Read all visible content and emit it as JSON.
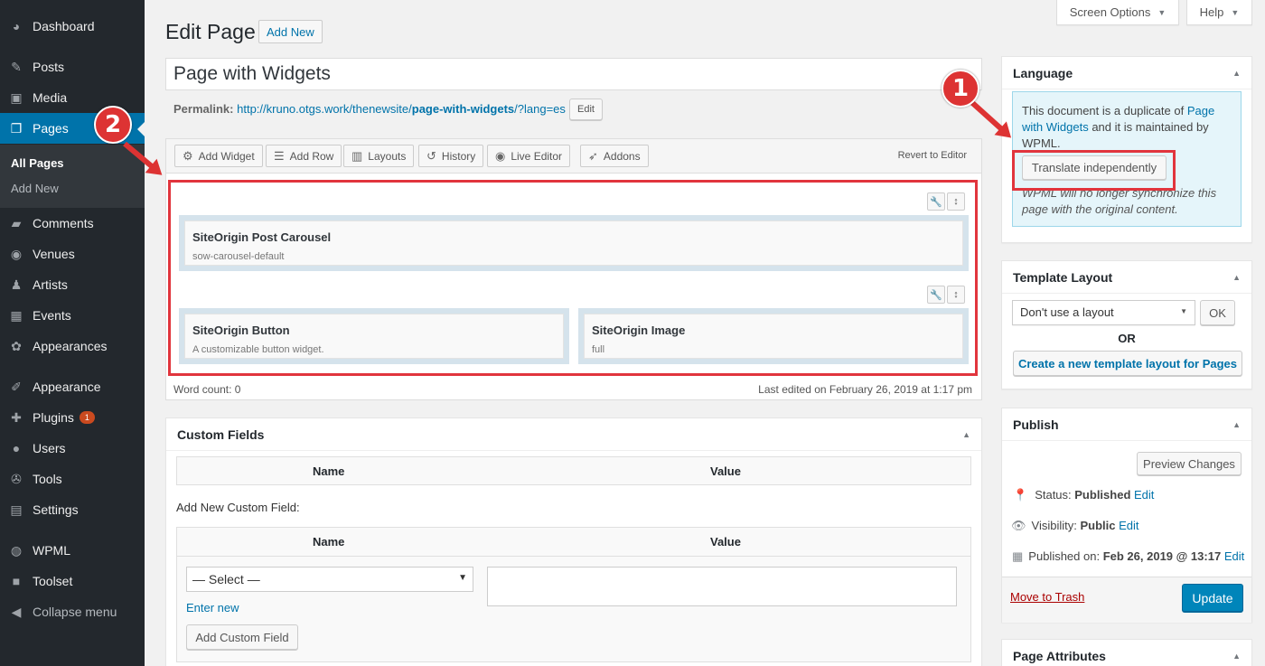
{
  "sidebar": {
    "items": [
      {
        "label": "Dashboard",
        "icon": "dashboard-icon"
      },
      {
        "label": "Posts",
        "icon": "pin-icon"
      },
      {
        "label": "Media",
        "icon": "media-icon"
      },
      {
        "label": "Pages",
        "icon": "pages-icon"
      },
      {
        "label": "Comments",
        "icon": "comment-icon"
      },
      {
        "label": "Venues",
        "icon": "globe-icon"
      },
      {
        "label": "Artists",
        "icon": "users-icon"
      },
      {
        "label": "Events",
        "icon": "calendar-icon"
      },
      {
        "label": "Appearances",
        "icon": "palette-icon"
      },
      {
        "label": "Appearance",
        "icon": "brush-icon"
      },
      {
        "label": "Plugins",
        "icon": "plugin-icon",
        "badge": "1"
      },
      {
        "label": "Users",
        "icon": "user-icon"
      },
      {
        "label": "Tools",
        "icon": "wrench-icon"
      },
      {
        "label": "Settings",
        "icon": "settings-icon"
      },
      {
        "label": "WPML",
        "icon": "wpml-icon"
      },
      {
        "label": "Toolset",
        "icon": "toolset-icon"
      },
      {
        "label": "Collapse menu",
        "icon": "collapse-icon"
      }
    ],
    "submenu": [
      "All Pages",
      "Add New"
    ]
  },
  "top": {
    "screen_options": "Screen Options",
    "help": "Help"
  },
  "header": {
    "title": "Edit Page",
    "add_new": "Add New"
  },
  "post": {
    "title": "Page with Widgets",
    "permalink_label": "Permalink:",
    "permalink_base": "http://kruno.otgs.work/thenewsite/",
    "permalink_slug": "page-with-widgets",
    "permalink_tail": "/?lang=es",
    "permalink_edit": "Edit"
  },
  "builder": {
    "toolbar": [
      "Add Widget",
      "Add Row",
      "Layouts",
      "History",
      "Live Editor",
      "Addons"
    ],
    "revert": "Revert to Editor",
    "widgets": [
      {
        "title": "SiteOrigin Post Carousel",
        "desc": "sow-carousel-default"
      },
      {
        "title": "SiteOrigin Button",
        "desc": "A customizable button widget."
      },
      {
        "title": "SiteOrigin Image",
        "desc": "full"
      }
    ],
    "word_count": "Word count: 0",
    "last_edited": "Last edited on February 26, 2019 at 1:17 pm"
  },
  "custom_fields": {
    "title": "Custom Fields",
    "col_name": "Name",
    "col_value": "Value",
    "add_new_label": "Add New Custom Field:",
    "select_value": "— Select —",
    "enter_new": "Enter new",
    "add_button": "Add Custom Field"
  },
  "language": {
    "title": "Language",
    "note_pre": "This document is a duplicate of ",
    "note_link": "Page with Widgets",
    "note_post": " and it is maintained by WPML.",
    "button": "Translate independently",
    "hint": "WPML will no longer synchronize this page with the original content."
  },
  "template": {
    "title": "Template Layout",
    "select": "Don't use a layout",
    "ok": "OK",
    "or": "OR",
    "create": "Create a new template layout for Pages"
  },
  "publish": {
    "title": "Publish",
    "preview": "Preview Changes",
    "status_label": "Status: ",
    "status_value": "Published",
    "visibility_label": "Visibility: ",
    "visibility_value": "Public",
    "published_label": "Published on: ",
    "published_value": "Feb 26, 2019 @ 13:17",
    "edit": "Edit",
    "trash": "Move to Trash",
    "update": "Update"
  },
  "page_attributes": {
    "title": "Page Attributes"
  },
  "annotations": {
    "one": "1",
    "two": "2"
  },
  "colors": {
    "accent": "#0073aa",
    "sidebar": "#23282d",
    "annotation": "#dd3333"
  }
}
